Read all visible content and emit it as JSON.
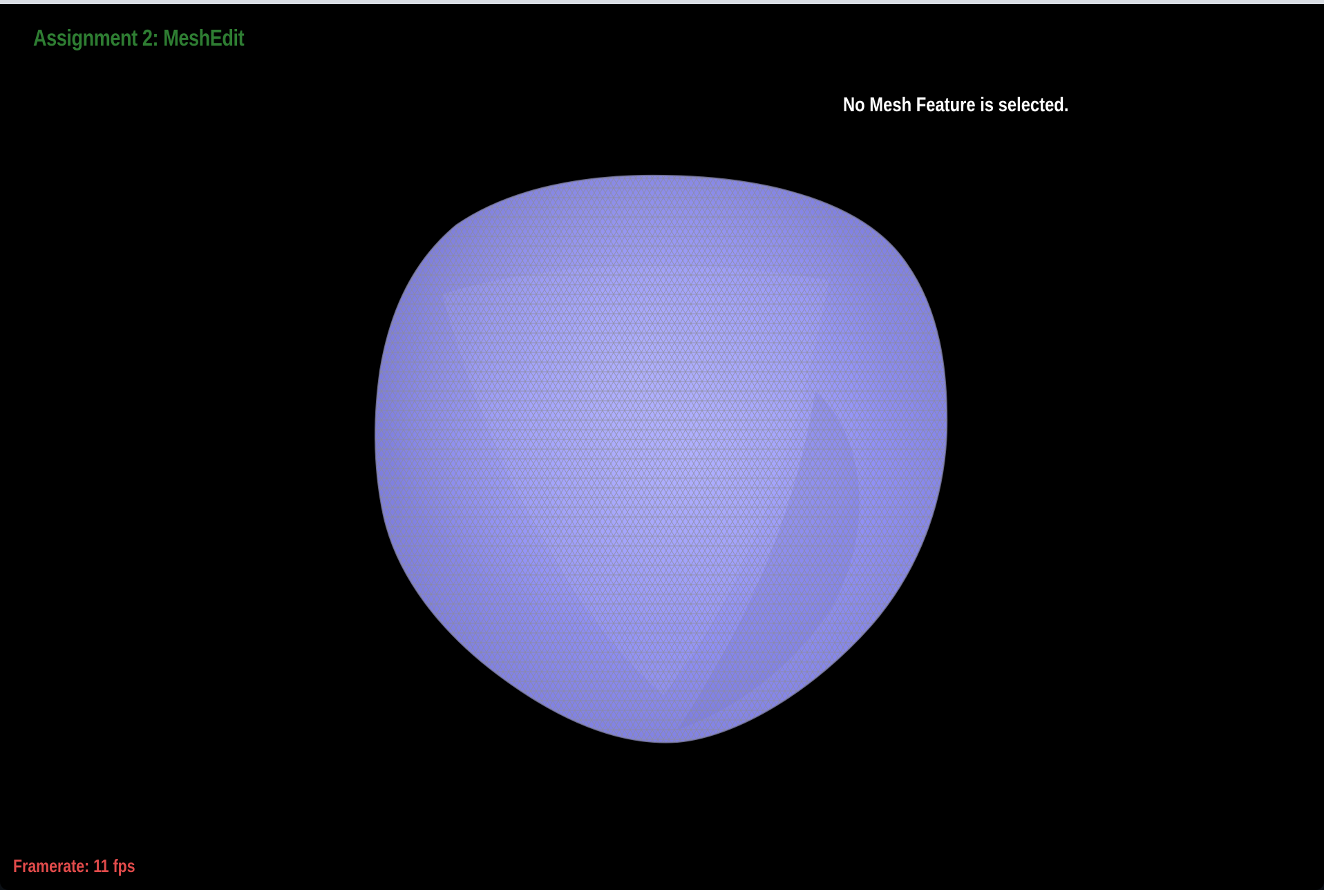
{
  "app": {
    "title": "Assignment 2: MeshEdit",
    "selection_status": "No Mesh Feature is selected.",
    "framerate": "Framerate: 11 fps"
  },
  "viewport": {
    "background": "#000000",
    "mesh_fill": "#9a9af5",
    "mesh_wire": "#8f8f9a"
  },
  "colors": {
    "title": "#2e7d32",
    "status": "#ffffff",
    "framerate": "#e24b4b"
  }
}
